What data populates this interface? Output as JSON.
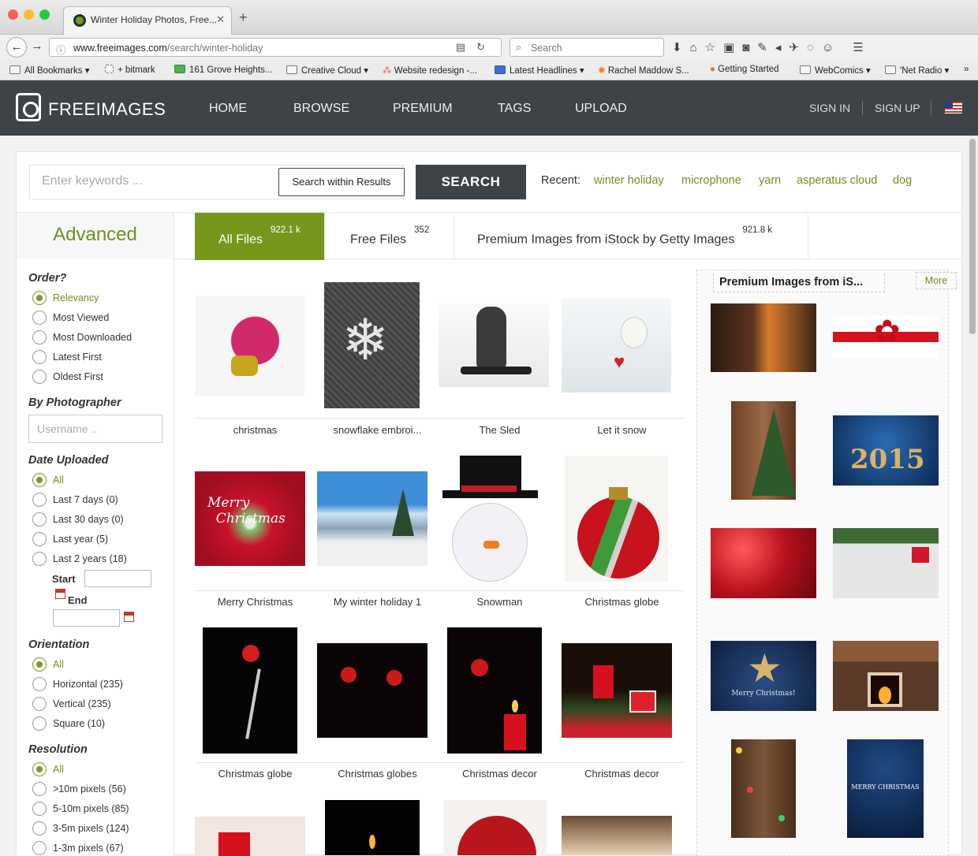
{
  "browser": {
    "tab_title": "Winter Holiday Photos, Free...",
    "url_domain": "www.freeimages.com",
    "url_path": "/search/winter-holiday",
    "search_placeholder": "Search",
    "bookmarks": [
      "All Bookmarks",
      "bitmark",
      "161 Grove Heights...",
      "Creative Cloud",
      "Website redesign -...",
      "Latest Headlines",
      "Rachel Maddow S...",
      "Getting Started",
      "WebComics",
      "'Net Radio"
    ]
  },
  "site": {
    "logo": "FREEIMAGES",
    "nav": [
      "HOME",
      "BROWSE",
      "PREMIUM",
      "TAGS",
      "UPLOAD"
    ],
    "sign_in": "SIGN IN",
    "sign_up": "SIGN UP",
    "accent": "#76971c",
    "header_bg": "#3d4347"
  },
  "search": {
    "placeholder": "Enter keywords ...",
    "within_label": "Search within Results",
    "button": "SEARCH",
    "recent_label": "Recent:",
    "recent": [
      "winter holiday",
      "microphone",
      "yarn",
      "asperatus cloud",
      "dog"
    ]
  },
  "tabs": {
    "advanced": "Advanced",
    "all": {
      "label": "All Files",
      "count": "922.1 k"
    },
    "free": {
      "label": "Free Files",
      "count": "352"
    },
    "premium": {
      "label": "Premium Images from iStock by Getty Images",
      "count": "921.8 k"
    }
  },
  "filters": {
    "order": {
      "title": "Order?",
      "options": [
        "Relevancy",
        "Most Viewed",
        "Most Downloaded",
        "Latest First",
        "Oldest First"
      ]
    },
    "photographer": {
      "title": "By Photographer",
      "placeholder": "Username .."
    },
    "date": {
      "title": "Date Uploaded",
      "options": [
        "All",
        "Last 7 days (0)",
        "Last 30 days (0)",
        "Last year (5)",
        "Last 2 years (18)"
      ],
      "start": "Start",
      "end": "End"
    },
    "orientation": {
      "title": "Orientation",
      "options": [
        "All",
        "Horizontal (235)",
        "Vertical (235)",
        "Square (10)"
      ]
    },
    "resolution": {
      "title": "Resolution",
      "options": [
        "All",
        ">10m pixels (56)",
        "5-10m pixels (85)",
        "3-5m pixels (124)",
        "1-3m pixels (67)"
      ]
    }
  },
  "results": [
    "christmas",
    "snowflake embroi...",
    "The Sled",
    "Let it snow",
    "Merry Christmas",
    "My winter holiday 1",
    "Snowman",
    "Christmas globe",
    "Christmas globe",
    "Christmas globes",
    "Christmas decor",
    "Christmas decor"
  ],
  "premium_panel": {
    "title": "Premium Images from iS...",
    "more": "More",
    "image_text": [
      "Merry Christmas!",
      "MERRY CHRISTMAS"
    ],
    "year": "2015"
  }
}
